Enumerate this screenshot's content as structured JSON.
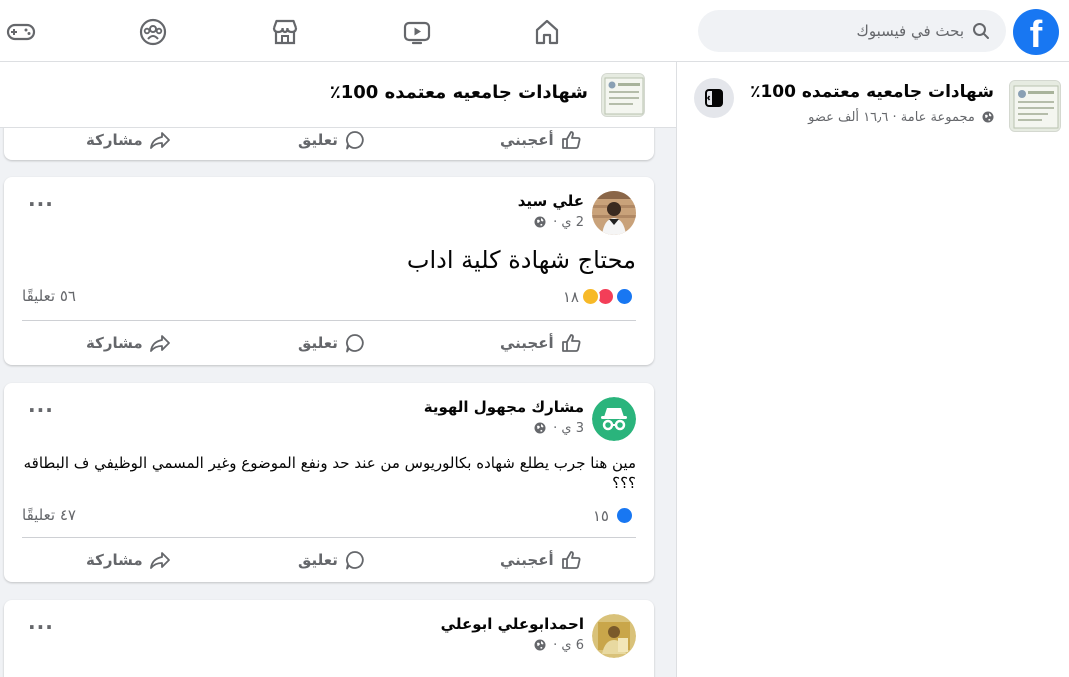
{
  "topbar": {
    "logo_letter": "f",
    "search_placeholder": "بحث في فيسبوك",
    "icons": [
      "facebook-logo-icon",
      "search-icon",
      "home-icon",
      "watch-icon",
      "marketplace-icon",
      "groups-icon",
      "gaming-icon"
    ]
  },
  "group": {
    "name": "شهادات جامعيه معتمده 100٪",
    "meta": "مجموعة عامة · ١٦٫٦ ألف عضو"
  },
  "actions": {
    "like": "أعجبني",
    "comment": "تعليق",
    "share": "مشاركة"
  },
  "posts": [
    {
      "author": "علي سيد",
      "time": "2 ي ·",
      "text": "محتاج شهادة كلية اداب",
      "reaction_count": "١٨",
      "reactions": [
        "like",
        "love",
        "haha"
      ],
      "comment_count": "٥٦ تعليقًا"
    },
    {
      "author": "مشارك مجهول الهوية",
      "time": "3 ي ·",
      "text": "مين هنا جرب يطلع شهاده بكالوريوس من عند حد ونفع الموضوع وغير المسمي الوظيفي ف البطاقه ؟؟؟",
      "reaction_count": "١٥",
      "reactions": [
        "like"
      ],
      "comment_count": "٤٧ تعليقًا"
    },
    {
      "author": "احمدابوعلي ابوعلي",
      "time": "6 ي ·"
    }
  ],
  "colors": {
    "brand": "#1877f2",
    "love": "#f33e58",
    "haha": "#f7b928",
    "anonymous": "#2ab47c",
    "secondary_text": "#65676b"
  }
}
